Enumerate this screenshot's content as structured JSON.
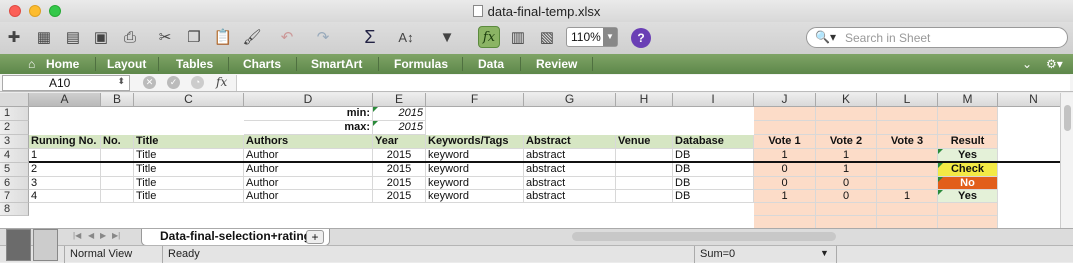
{
  "window": {
    "title": "data-final-temp.xlsx"
  },
  "toolbar": {
    "zoom": "110%",
    "search_placeholder": "Search in Sheet",
    "help": "?"
  },
  "ribbon": {
    "tabs": [
      "Home",
      "Layout",
      "Tables",
      "Charts",
      "SmartArt",
      "Formulas",
      "Data",
      "Review"
    ]
  },
  "formula_bar": {
    "name_box": "A10",
    "fx": "fx",
    "value": ""
  },
  "columns": [
    "A",
    "B",
    "C",
    "D",
    "E",
    "F",
    "G",
    "H",
    "I",
    "J",
    "K",
    "L",
    "M",
    "N"
  ],
  "rows": [
    "1",
    "2",
    "3",
    "4",
    "5",
    "6",
    "7",
    "8"
  ],
  "sheet": {
    "row1": {
      "label": "min:",
      "year": "2015"
    },
    "row2": {
      "label": "max:",
      "year": "2015"
    },
    "headers": [
      "Running No.",
      "No.",
      "Title",
      "Authors",
      "Year",
      "Keywords/Tags",
      "Abstract",
      "Venue",
      "Database",
      "Vote 1",
      "Vote 2",
      "Vote 3",
      "Result"
    ],
    "data": [
      {
        "running": "1",
        "title": "Title",
        "author": "Author",
        "year": "2015",
        "keyword": "keyword",
        "abstract": "abstract",
        "db": "DB",
        "v1": "1",
        "v2": "1",
        "v3": "",
        "result": "Yes",
        "status": "green"
      },
      {
        "running": "2",
        "title": "Title",
        "author": "Author",
        "year": "2015",
        "keyword": "keyword",
        "abstract": "abstract",
        "db": "DB",
        "v1": "0",
        "v2": "1",
        "v3": "",
        "result": "Check",
        "status": "yellow"
      },
      {
        "running": "3",
        "title": "Title",
        "author": "Author",
        "year": "2015",
        "keyword": "keyword",
        "abstract": "abstract",
        "db": "DB",
        "v1": "0",
        "v2": "0",
        "v3": "",
        "result": "No",
        "status": "orange"
      },
      {
        "running": "4",
        "title": "Title",
        "author": "Author",
        "year": "2015",
        "keyword": "keyword",
        "abstract": "abstract",
        "db": "DB",
        "v1": "1",
        "v2": "0",
        "v3": "1",
        "result": "Yes",
        "status": "green"
      }
    ]
  },
  "tabs": {
    "active_sheet": "Data-final-selection+rating",
    "add": "+"
  },
  "status": {
    "view": "Normal View",
    "state": "Ready",
    "sum": "Sum=0"
  },
  "colors": {
    "header_green": "#d6e6c3",
    "vote_peach": "#fcdcc8",
    "yes": "#e4f1d8",
    "check": "#f3ea45",
    "no": "#e25e1b",
    "ribbon": "#6f985a"
  }
}
